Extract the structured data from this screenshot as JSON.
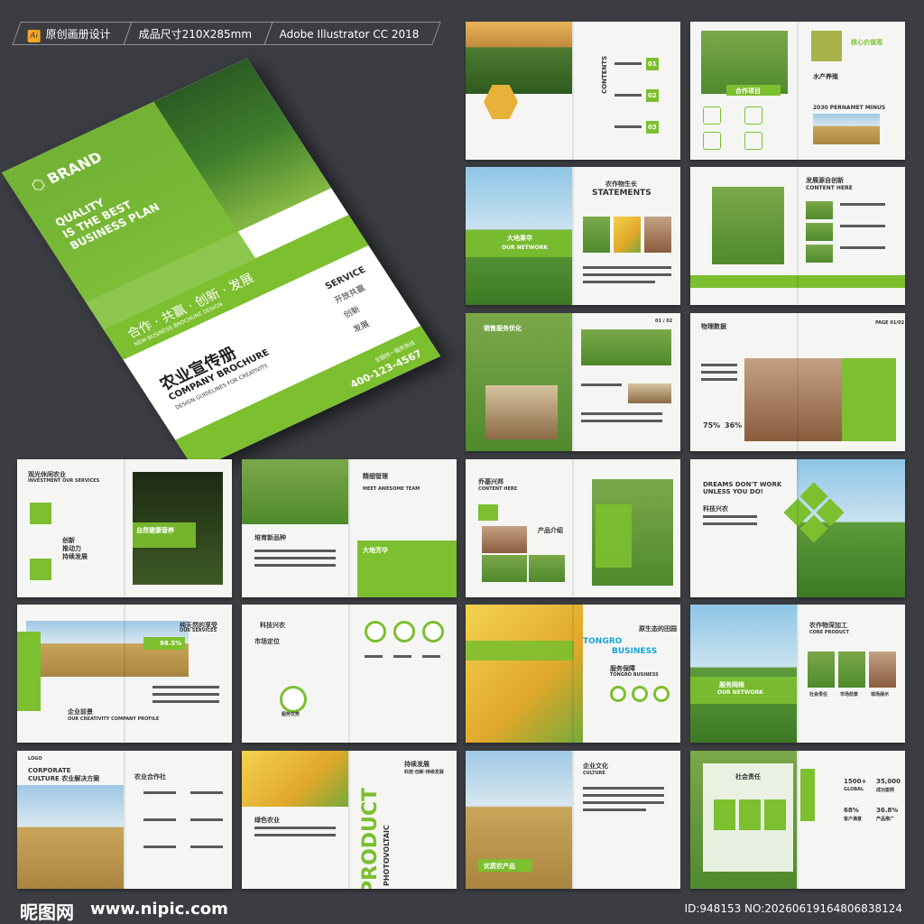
{
  "header": {
    "tag1": "原创画册设计",
    "tag1_icon": "Ai",
    "tag2": "成品尺寸210X285mm",
    "tag3": "Adobe Illustrator CC 2018"
  },
  "cover": {
    "brand": "BRAND",
    "quality_line1": "QUALITY",
    "quality_line2": "IS THE BEST",
    "quality_line3": "BUSINESS PLAN",
    "slogan": "合作 · 共赢 · 创新 · 发展",
    "slogan_sub": "NEW BUSINESS BROCHURE DESIGN",
    "title_cn": "农业宣传册",
    "title_en": "COMPANY BROCHURE",
    "design_line": "DESIGN GUIDELINES FOR CREATIVITY.",
    "service": "SERVICE",
    "service_items": [
      "开放共赢",
      "创新",
      "发展"
    ],
    "hotline_label": "全国统一服务热线",
    "phone": "400-123-4567"
  },
  "spreads": {
    "s1": {
      "label": "CONTENTS",
      "nums": [
        "01",
        "02",
        "03"
      ]
    },
    "s2": {
      "label": "核心价值观",
      "sub": "水产养殖",
      "sub2": "2030 PERNAMET MINUS",
      "tag": "合作项目"
    },
    "s3": {
      "label": "农作物生长",
      "label_en": "STATEMENTS",
      "green": "大地果华",
      "green_en": "OUR NETWORK"
    },
    "s4": {
      "label": "发展源自创新",
      "label_en": "CONTENT HERE"
    },
    "s5": {
      "label": "销售服务优化",
      "page": "01 / 02"
    },
    "s6": {
      "label": "物理数据",
      "stat1": "75%",
      "stat2": "36%",
      "page": "PAGE 01/02"
    },
    "s7": {
      "label": "观光休闲农业",
      "label_en": "INVESTMENT OUR SERVICES",
      "green": "自然健康营养",
      "items": [
        "创新",
        "推动力",
        "持续发展"
      ]
    },
    "s8": {
      "label": "精细管理",
      "sub": "MEET AWESOME TEAM",
      "sub2": "培育新品种",
      "green": "大地芳华"
    },
    "s9": {
      "label": "乔基兴邦",
      "label_en": "CONTENT HERE",
      "sub": "产品介绍"
    },
    "s10": {
      "label": "DREAMS DON'T WORK",
      "label2": "UNLESS YOU DO!",
      "sub": "科技兴农"
    },
    "s11": {
      "label": "纯天然的享受",
      "label_en": "OUR SERVICES",
      "stat": "98.5%",
      "sub": "企业前景",
      "sub_en": "OUR CREATIVITY COMPANY PROFILE"
    },
    "s12": {
      "label": "科技兴农",
      "sub": "市场定位",
      "center": "服务优势"
    },
    "s13": {
      "label": "原生态的田园",
      "brand": "TONGRO",
      "brand2": "BUSINESS",
      "sub": "服务保障",
      "sub_en": "TONGRO BUSINESS"
    },
    "s14": {
      "label": "农作物深加工",
      "label_en": "CORE PRODUCT",
      "green": "服务网络",
      "green_en": "OUR NETWORK",
      "items": [
        "社会责任",
        "市场前景",
        "现场展示"
      ]
    },
    "s15": {
      "label": "CORPORATE",
      "label2": "CULTURE 农业解决方案",
      "sub": "农业合作社",
      "logo": "LOGO"
    },
    "s16": {
      "label": "持续发展",
      "sub": "科技·创新·持续发展",
      "big": "PRODUCT",
      "big2": "PHOTOVOLTAIC",
      "sub2": "绿色农业"
    },
    "s17": {
      "label": "企业文化",
      "label_en": "CULTURE",
      "tag": "优质农产品"
    },
    "s18": {
      "label": "社会责任",
      "stats": [
        "1500+",
        "35,000",
        "68%",
        "36.8%"
      ],
      "stat_labels": [
        "GLOBAL",
        "成功案例",
        "客户满意",
        "产品推广"
      ]
    }
  },
  "footer": {
    "logo": "昵图网",
    "site": "www.nipic.com",
    "id": "ID:948153 NO:20260619164806838124"
  },
  "colors": {
    "accent": "#7cbf2f",
    "background": "#3b3d42"
  }
}
